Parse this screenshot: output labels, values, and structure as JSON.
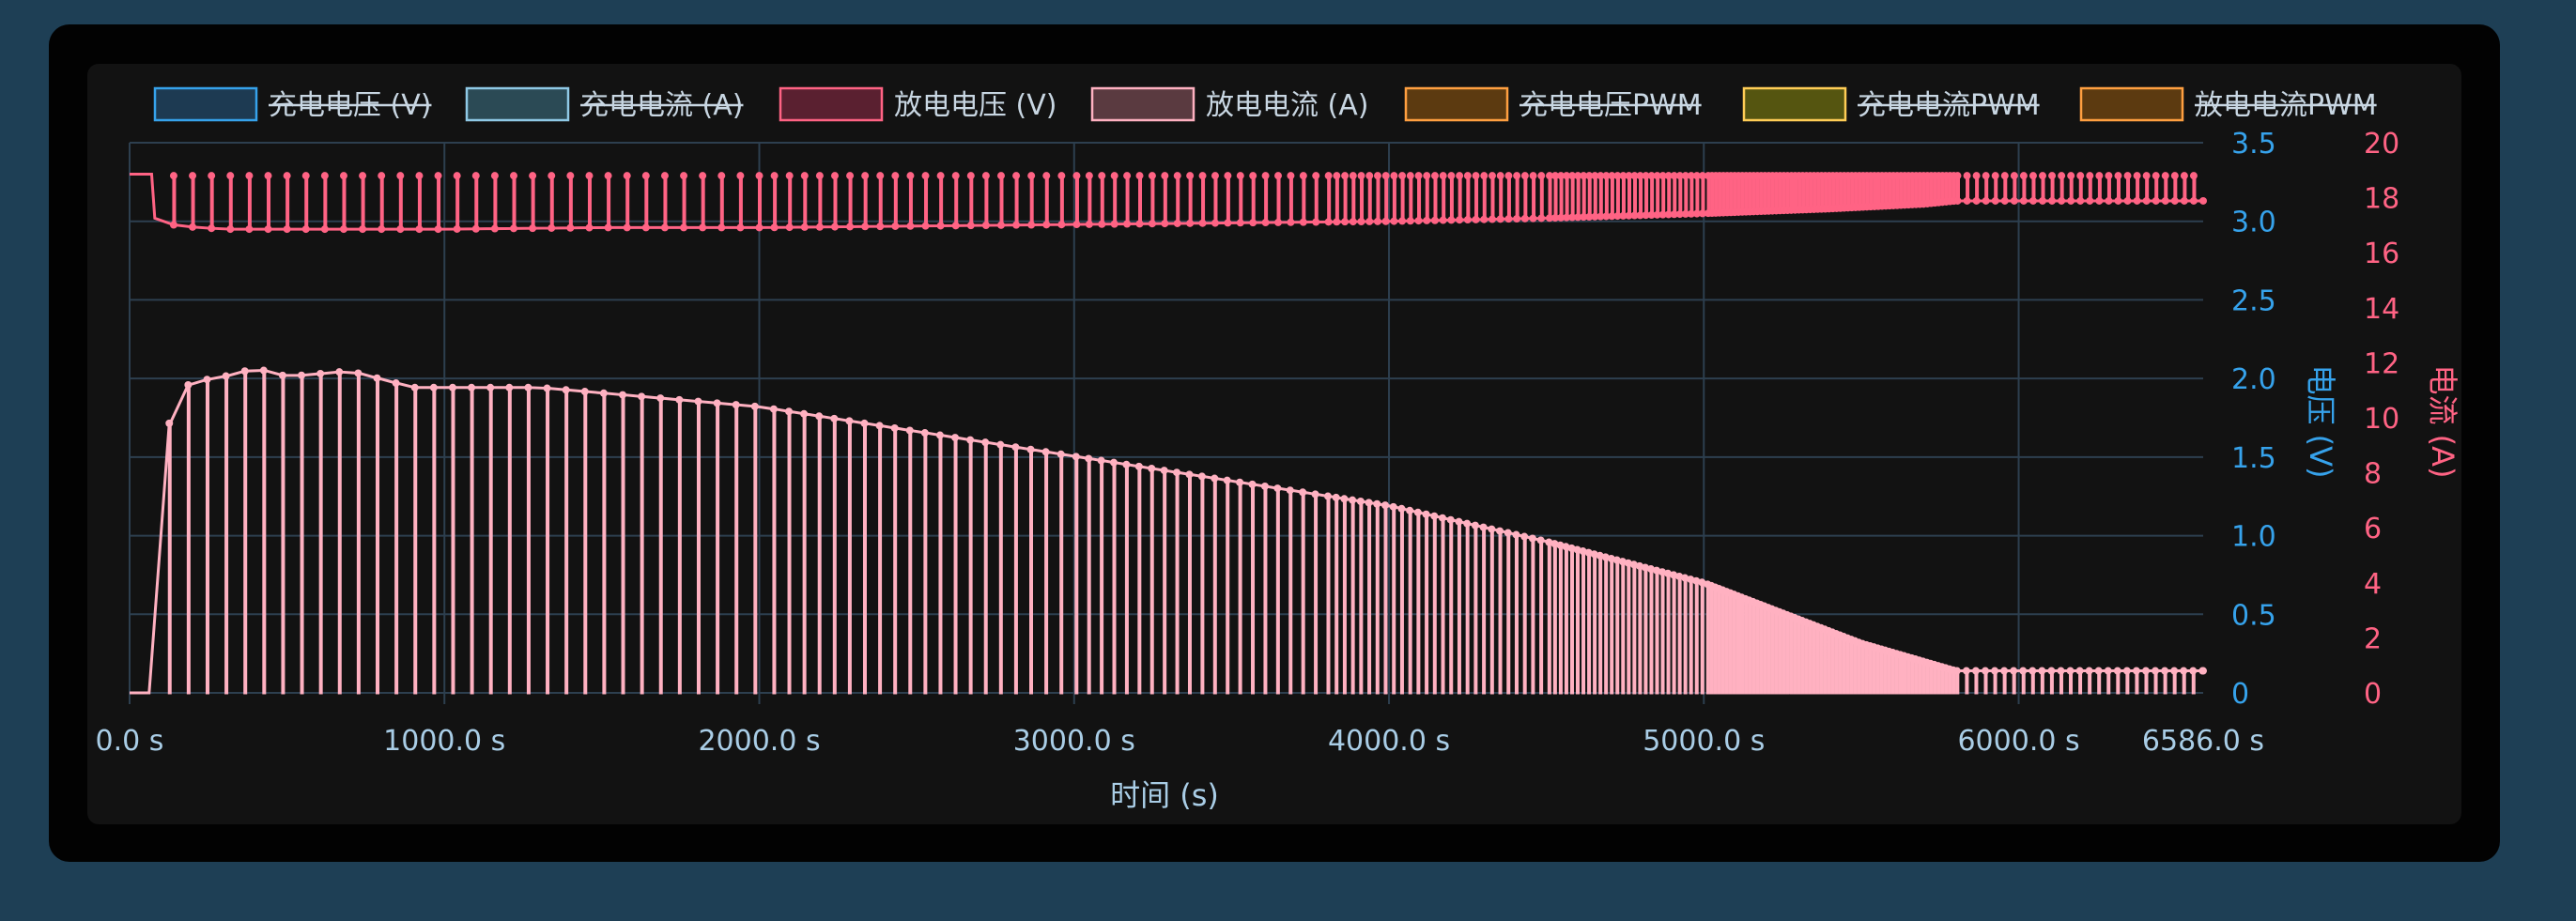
{
  "chart_data": {
    "type": "line",
    "xlabel": "时间 (s)",
    "y_left_label": "电压 (V)",
    "y_right_label": "电流 (A)",
    "x_range": [
      0,
      6586
    ],
    "x_ticks": [
      "0.0 s",
      "1000.0 s",
      "2000.0 s",
      "3000.0 s",
      "4000.0 s",
      "5000.0 s",
      "6000.0 s",
      "6586.0 s"
    ],
    "x_tick_values": [
      0,
      1000,
      2000,
      3000,
      4000,
      5000,
      6000,
      6586
    ],
    "y_left_range": [
      0,
      3.5
    ],
    "y_left_ticks": [
      "0",
      "0.5",
      "1.0",
      "1.5",
      "2.0",
      "2.5",
      "3.0",
      "3.5"
    ],
    "y_left_tick_values": [
      0,
      0.5,
      1.0,
      1.5,
      2.0,
      2.5,
      3.0,
      3.5
    ],
    "y_right_range": [
      0,
      20
    ],
    "y_right_ticks": [
      "0",
      "2",
      "4",
      "6",
      "8",
      "10",
      "12",
      "14",
      "16",
      "18",
      "20"
    ],
    "y_right_tick_values": [
      0,
      2,
      4,
      6,
      8,
      10,
      12,
      14,
      16,
      18,
      20
    ],
    "grid": true,
    "legend_position": "top",
    "legend": [
      {
        "label": "充电电压 (V)",
        "hidden": true,
        "stroke": "#36a2eb",
        "fill": "#1d3a52"
      },
      {
        "label": "充电电流 (A)",
        "hidden": true,
        "stroke": "#8fc9e6",
        "fill": "#2b4a55"
      },
      {
        "label": "放电电压 (V)",
        "hidden": false,
        "stroke": "#ff6384",
        "fill": "#5a2030"
      },
      {
        "label": "放电电流 (A)",
        "hidden": false,
        "stroke": "#ffb1c1",
        "fill": "#5a3a40"
      },
      {
        "label": "充电电压PWM",
        "hidden": true,
        "stroke": "#ff9f40",
        "fill": "#5c3a10"
      },
      {
        "label": "充电电流PWM",
        "hidden": true,
        "stroke": "#ffcd56",
        "fill": "#555510"
      },
      {
        "label": "放电电流PWM",
        "hidden": true,
        "stroke": "#ff9f40",
        "fill": "#5c3a10"
      }
    ],
    "series": [
      {
        "name": "放电电压 (V)",
        "axis": "left",
        "color": "#ff6384",
        "x": [
          0,
          70,
          80,
          150,
          300,
          500,
          800,
          1000,
          1500,
          2000,
          2500,
          3000,
          3500,
          4000,
          4500,
          5000,
          5400,
          5700,
          5800,
          6586
        ],
        "values": [
          3.3,
          3.3,
          3.02,
          2.97,
          2.95,
          2.95,
          2.95,
          2.95,
          2.96,
          2.96,
          2.97,
          2.98,
          2.99,
          3.0,
          3.02,
          3.05,
          3.08,
          3.11,
          3.13,
          3.13
        ],
        "spike_to": 3.29
      },
      {
        "name": "放电电流 (A)",
        "axis": "right",
        "color": "#ffb1c1",
        "x": [
          0,
          60,
          70,
          75,
          80,
          100,
          120,
          140,
          160,
          200,
          300,
          400,
          500,
          600,
          700,
          800,
          900,
          1000,
          1300,
          1500,
          2000,
          2500,
          3000,
          3500,
          4000,
          4500,
          5000,
          5500,
          5800,
          6586
        ],
        "values": [
          0,
          0,
          1,
          6.5,
          7,
          8.5,
          9.5,
          10.5,
          11,
          11.3,
          11.5,
          11.8,
          11.5,
          11.6,
          11.7,
          11.4,
          11.1,
          11.1,
          11.1,
          10.9,
          10.4,
          9.5,
          8.6,
          7.7,
          6.8,
          5.5,
          4,
          1.8,
          0.8,
          0.8
        ],
        "dip_to": 0
      }
    ]
  }
}
